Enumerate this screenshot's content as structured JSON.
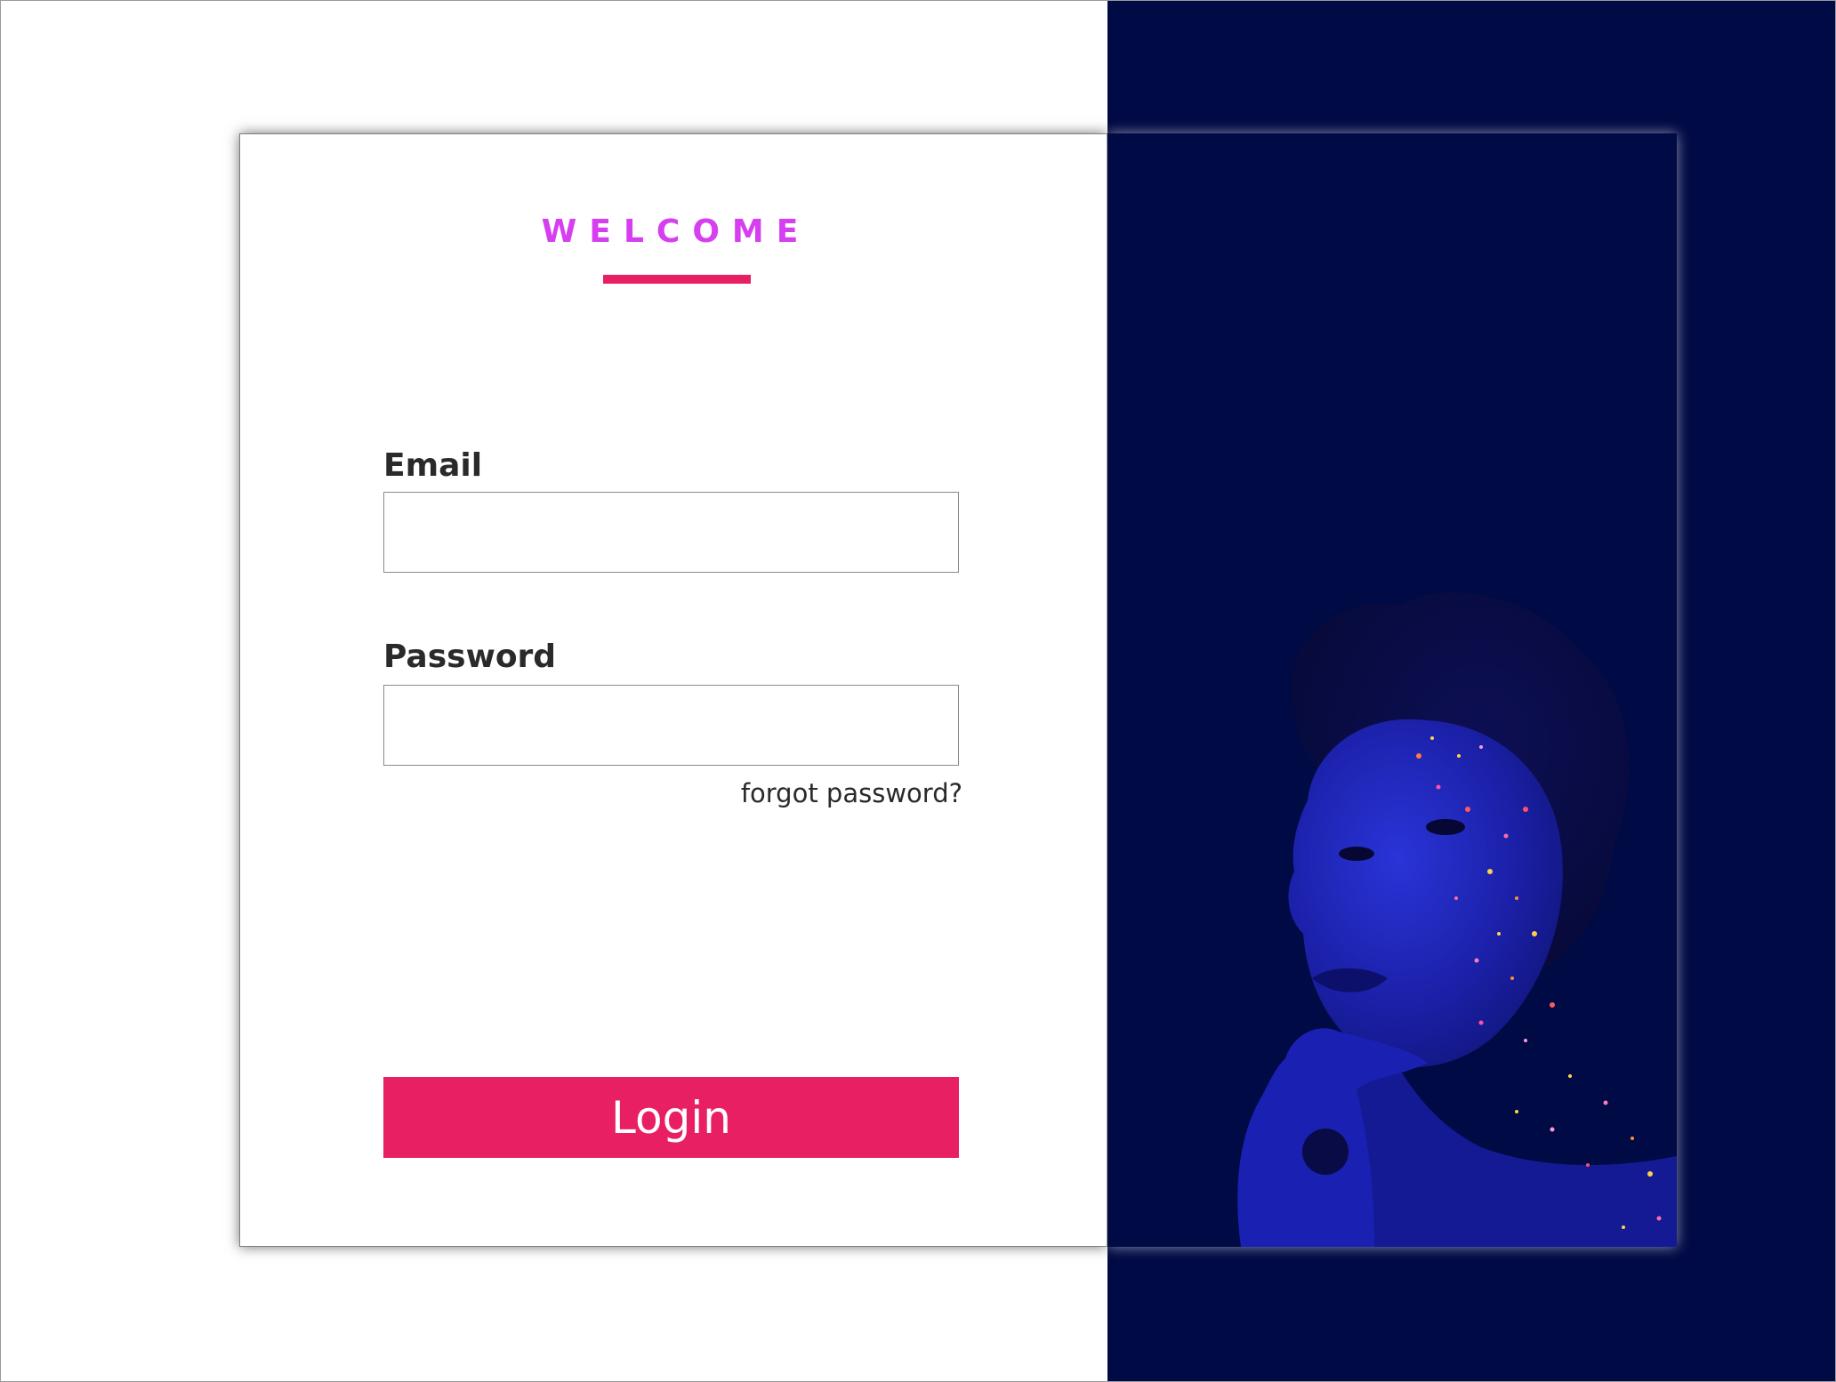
{
  "login": {
    "title": "WELCOME",
    "email_label": "Email",
    "email_value": "",
    "password_label": "Password",
    "password_value": "",
    "forgot_link": "forgot password?",
    "login_button": "Login"
  },
  "theme": {
    "accent_pink": "#e91f63",
    "title_magenta": "#d63ff0",
    "navy_background": "#000a45",
    "portrait_tint": "#1a1ecc"
  },
  "hero": {
    "image_subject": "portrait-with-glitter-face-paint"
  }
}
